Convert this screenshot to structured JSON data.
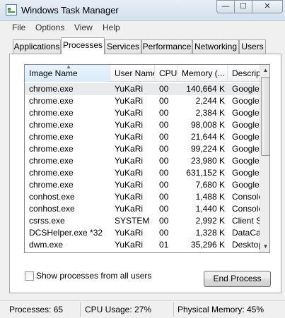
{
  "window": {
    "title": "Windows Task Manager",
    "min_glyph": "—",
    "max_glyph": "☐",
    "close_glyph": "✕"
  },
  "menu": [
    "File",
    "Options",
    "View",
    "Help"
  ],
  "tabs": [
    "Applications",
    "Processes",
    "Services",
    "Performance",
    "Networking",
    "Users"
  ],
  "active_tab": "Processes",
  "columns": [
    "Image Name",
    "User Name",
    "CPU",
    "Memory (...",
    "Descript"
  ],
  "sorted_column": "Image Name",
  "processes": [
    [
      "chrome.exe",
      "YuKaRi",
      "00",
      "140,664 K",
      "Google C"
    ],
    [
      "chrome.exe",
      "YuKaRi",
      "00",
      "2,244 K",
      "Google C"
    ],
    [
      "chrome.exe",
      "YuKaRi",
      "00",
      "2,384 K",
      "Google C"
    ],
    [
      "chrome.exe",
      "YuKaRi",
      "00",
      "98,008 K",
      "Google C"
    ],
    [
      "chrome.exe",
      "YuKaRi",
      "00",
      "21,644 K",
      "Google C"
    ],
    [
      "chrome.exe",
      "YuKaRi",
      "00",
      "99,224 K",
      "Google C"
    ],
    [
      "chrome.exe",
      "YuKaRi",
      "00",
      "23,980 K",
      "Google C"
    ],
    [
      "chrome.exe",
      "YuKaRi",
      "00",
      "631,152 K",
      "Google C"
    ],
    [
      "chrome.exe",
      "YuKaRi",
      "00",
      "7,680 K",
      "Google C"
    ],
    [
      "conhost.exe",
      "YuKaRi",
      "00",
      "1,488 K",
      "Console"
    ],
    [
      "conhost.exe",
      "YuKaRi",
      "00",
      "1,440 K",
      "Console"
    ],
    [
      "csrss.exe",
      "SYSTEM",
      "00",
      "2,992 K",
      "Client Se"
    ],
    [
      "DCSHelper.exe *32",
      "YuKaRi",
      "00",
      "1,328 K",
      "DataCar"
    ],
    [
      "dwm.exe",
      "YuKaRi",
      "01",
      "35,296 K",
      "Desktop"
    ]
  ],
  "selected_row": 0,
  "show_all_label": "Show processes from all users",
  "show_all_checked": false,
  "end_process_label": "End Process",
  "status": {
    "processes": "Processes: 65",
    "cpu": "CPU Usage: 27%",
    "memory": "Physical Memory: 45%"
  }
}
